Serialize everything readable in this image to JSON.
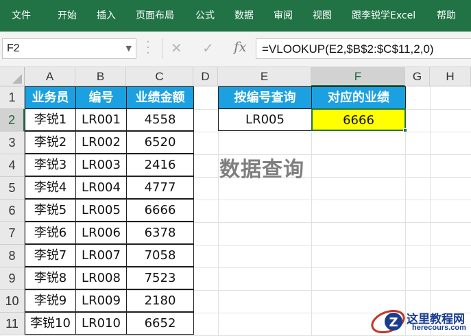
{
  "ribbon": {
    "tabs": [
      "文件",
      "开始",
      "插入",
      "页面布局",
      "公式",
      "数据",
      "审阅",
      "视图",
      "跟李锐学Excel",
      "帮助"
    ],
    "background": "#217346"
  },
  "formula_bar": {
    "name_box": "F2",
    "formula": "=VLOOKUP(E2,$B$2:$C$11,2,0)",
    "cancel_icon": "✕",
    "enter_icon": "✓",
    "fx_label": "fx"
  },
  "columns": [
    "A",
    "B",
    "C",
    "D",
    "E",
    "F",
    "G",
    "H"
  ],
  "rows": [
    "1",
    "2",
    "3",
    "4",
    "5",
    "6",
    "7",
    "8",
    "9",
    "10",
    "11"
  ],
  "selected_cell": {
    "column": "F",
    "row": "2"
  },
  "data_table": {
    "headers": [
      "业务员",
      "编号",
      "业绩金额"
    ],
    "rows": [
      [
        "李锐1",
        "LR001",
        "4558"
      ],
      [
        "李锐2",
        "LR002",
        "6520"
      ],
      [
        "李锐3",
        "LR003",
        "2416"
      ],
      [
        "李锐4",
        "LR004",
        "4777"
      ],
      [
        "李锐5",
        "LR005",
        "6666"
      ],
      [
        "李锐6",
        "LR006",
        "6378"
      ],
      [
        "李锐7",
        "LR007",
        "7058"
      ],
      [
        "李锐8",
        "LR008",
        "7523"
      ],
      [
        "李锐9",
        "LR009",
        "2180"
      ],
      [
        "李锐10",
        "LR010",
        "6652"
      ]
    ],
    "header_color": "#1ba1e2"
  },
  "lookup": {
    "headers": [
      "按编号查询",
      "对应的业绩"
    ],
    "input": "LR005",
    "result": "6666",
    "result_color": "#ffff00"
  },
  "annotation": "数据查询",
  "watermark": {
    "title": "这里教程网",
    "url": "herecours.com"
  }
}
